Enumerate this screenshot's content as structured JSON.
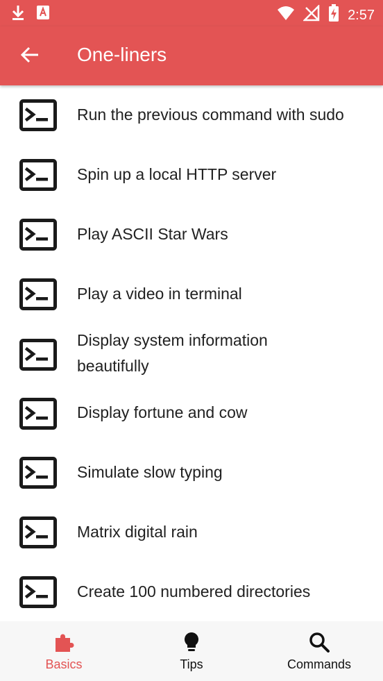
{
  "colors": {
    "accent": "#e35454",
    "text_primary": "#212121",
    "nav_inactive": "#111111",
    "nav_background": "#f7f7f7"
  },
  "status_bar": {
    "time": "2:57",
    "icons": [
      "download-icon",
      "app-notification-icon",
      "wifi-icon",
      "no-signal-icon",
      "battery-charging-icon"
    ]
  },
  "app_bar": {
    "title": "One-liners",
    "back_icon": "arrow-left-icon"
  },
  "list": {
    "item_icon": "terminal-icon",
    "items": [
      {
        "label": "Run the previous command with sudo"
      },
      {
        "label": "Spin up a local HTTP server"
      },
      {
        "label": "Play ASCII Star Wars"
      },
      {
        "label": "Play a video in terminal"
      },
      {
        "label": "Display system information beautifully"
      },
      {
        "label": "Display fortune and cow"
      },
      {
        "label": "Simulate slow typing"
      },
      {
        "label": "Matrix digital rain"
      },
      {
        "label": "Create 100 numbered directories"
      }
    ]
  },
  "bottom_nav": {
    "active": "Basics",
    "items": [
      {
        "label": "Basics",
        "icon": "puzzle-piece-icon"
      },
      {
        "label": "Tips",
        "icon": "lightbulb-icon"
      },
      {
        "label": "Commands",
        "icon": "search-icon"
      }
    ]
  }
}
